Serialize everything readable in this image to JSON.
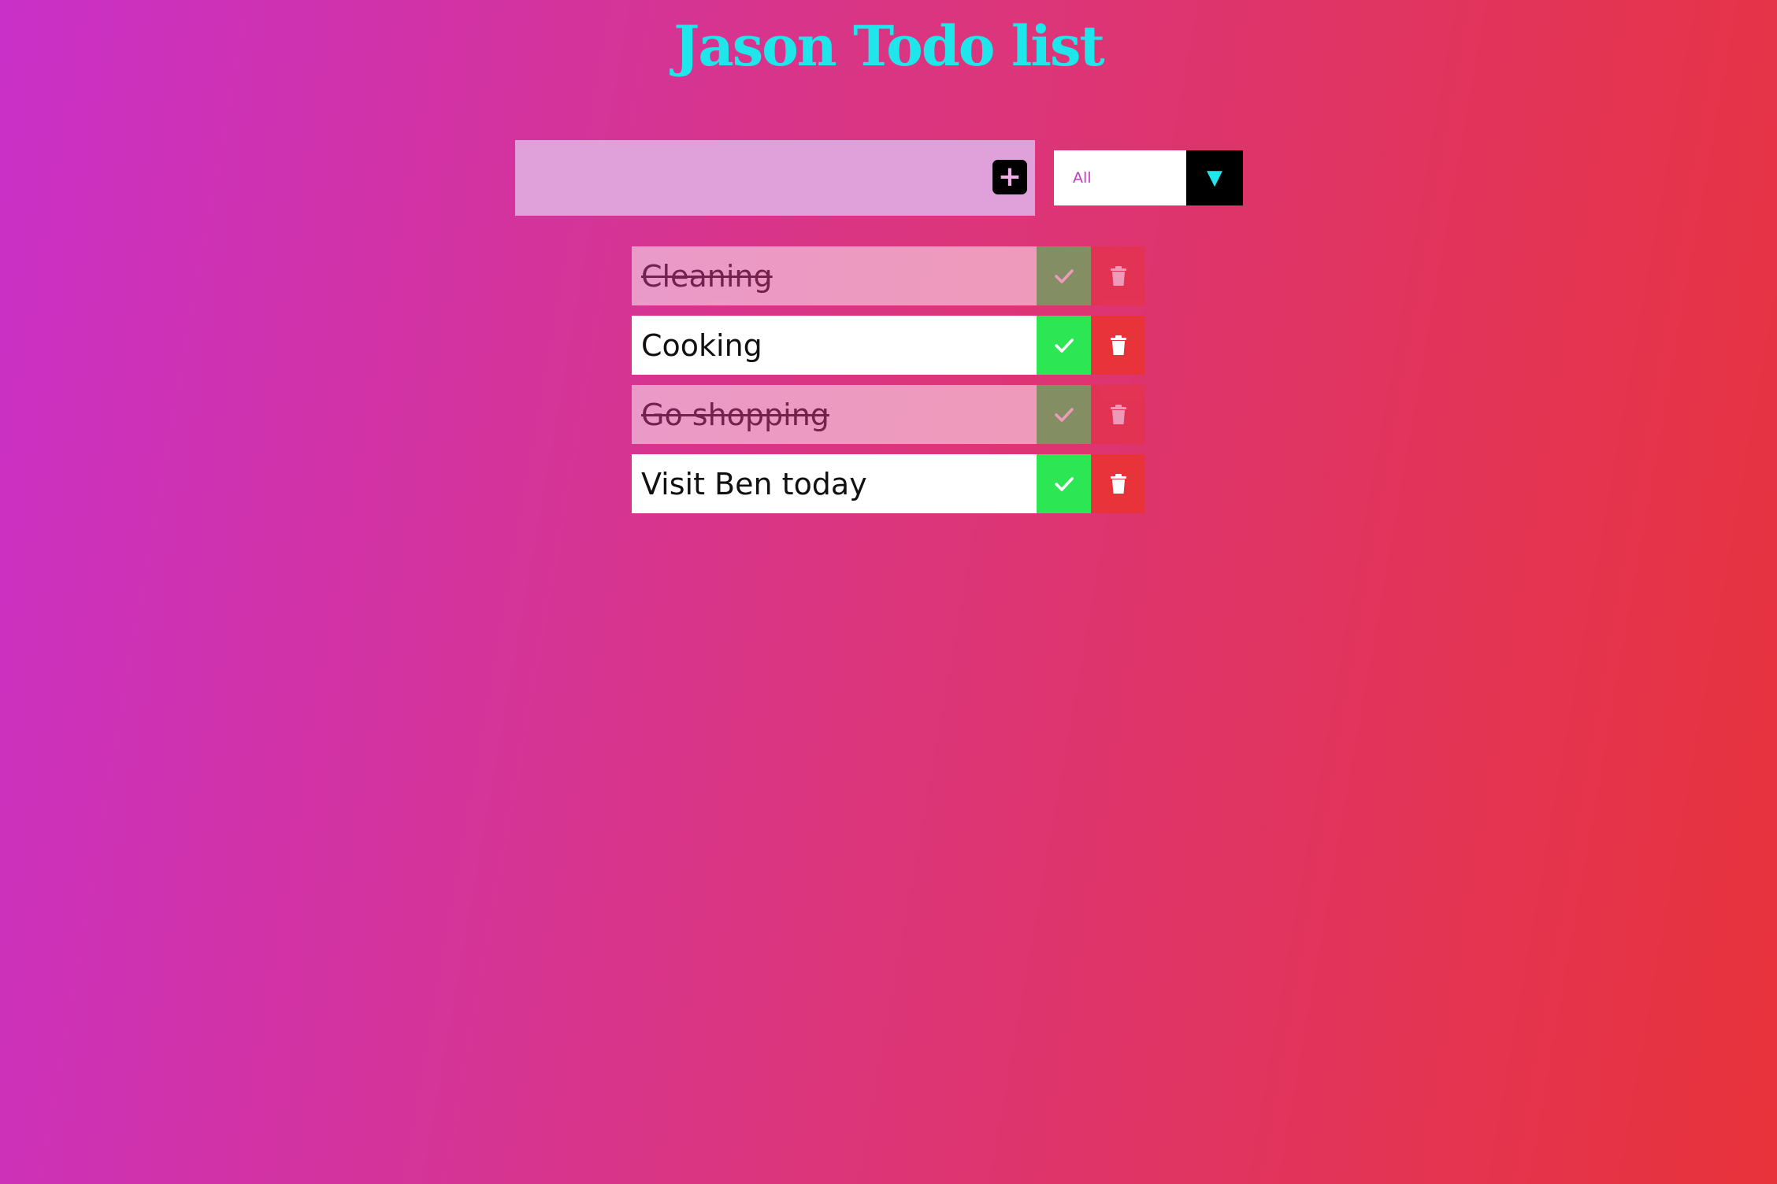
{
  "app": {
    "title": "Jason Todo list"
  },
  "input": {
    "value": "",
    "placeholder": "",
    "add_icon": "plus-icon"
  },
  "filter": {
    "selected": "All",
    "arrow_icon": "chevron-down-icon"
  },
  "todos": [
    {
      "text": "Cleaning",
      "completed": true
    },
    {
      "text": "Cooking",
      "completed": false
    },
    {
      "text": "Go shopping",
      "completed": true
    },
    {
      "text": "Visit Ben today",
      "completed": false
    }
  ],
  "colors": {
    "title": "#1ee6ea",
    "complete_button": "#2ce654",
    "trash_button": "#e8333a",
    "filter_text": "#c536bf"
  }
}
